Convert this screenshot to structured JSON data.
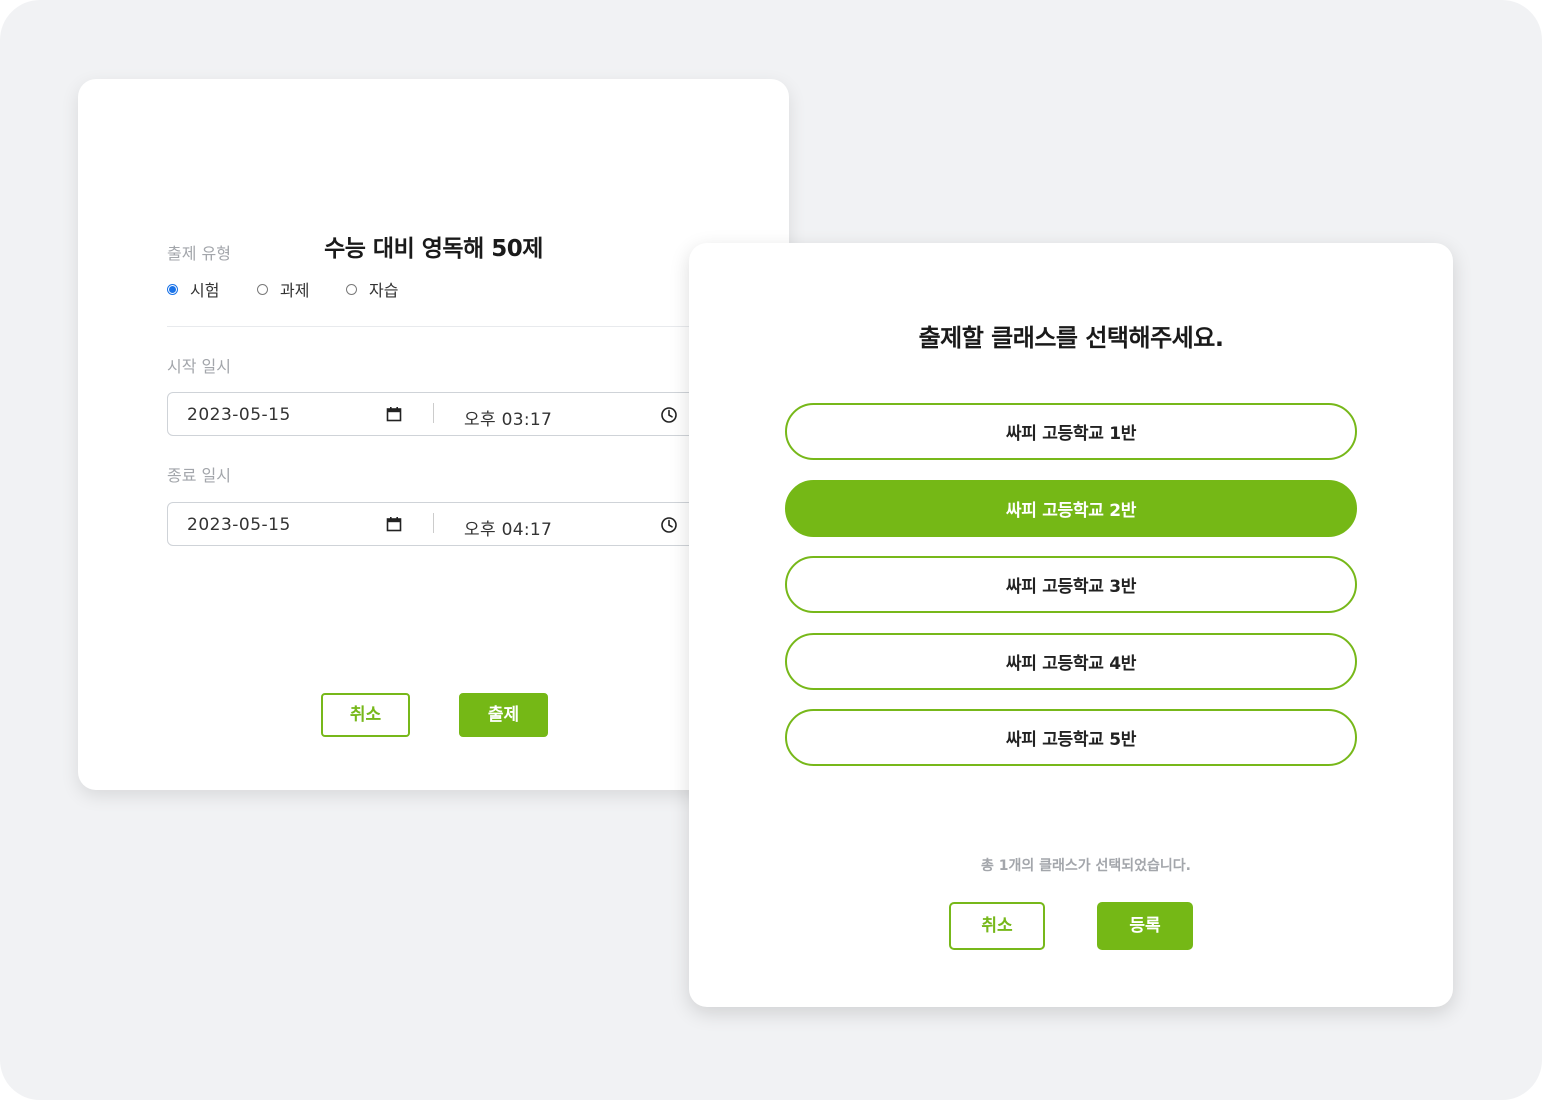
{
  "colors": {
    "accent": "#75b816",
    "background": "#f1f2f4",
    "label_gray": "#a3a6ab",
    "radio_blue": "#1a73e8"
  },
  "left_card": {
    "title": "수능 대비 영독해 50제",
    "type_label": "출제 유형",
    "types": [
      {
        "label": "시험",
        "selected": true
      },
      {
        "label": "과제",
        "selected": false
      },
      {
        "label": "자습",
        "selected": false
      }
    ],
    "start_label": "시작 일시",
    "start_date": "2023-05-15",
    "start_time": "오후 03:17",
    "end_label": "종료 일시",
    "end_date": "2023-05-15",
    "end_time": "오후 04:17",
    "cancel_label": "취소",
    "submit_label": "출제",
    "icons": {
      "date": "calendar-icon",
      "time": "clock-icon"
    }
  },
  "right_card": {
    "title": "출제할 클래스를 선택해주세요.",
    "classes": [
      {
        "label": "싸피 고등학교 1반",
        "selected": false
      },
      {
        "label": "싸피 고등학교 2반",
        "selected": true
      },
      {
        "label": "싸피 고등학교 3반",
        "selected": false
      },
      {
        "label": "싸피 고등학교 4반",
        "selected": false
      },
      {
        "label": "싸피 고등학교 5반",
        "selected": false
      }
    ],
    "summary": "총 1개의 클래스가 선택되었습니다.",
    "cancel_label": "취소",
    "register_label": "등록"
  }
}
